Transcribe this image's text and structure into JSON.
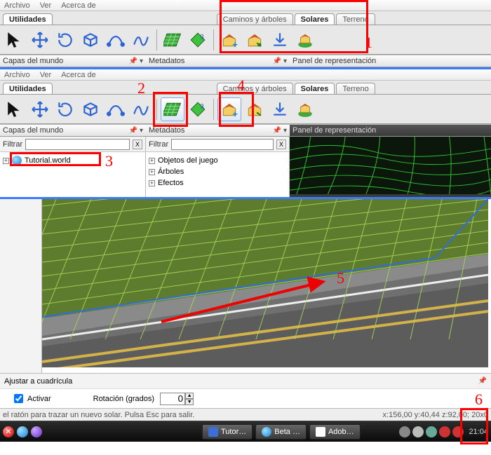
{
  "menu": {
    "archivo": "Archivo",
    "ver": "Ver",
    "acerca": "Acerca de"
  },
  "tabstrip1": {
    "utilidades": "Utilidades",
    "caminos": "Caminos y árboles",
    "solares": "Solares",
    "terreno": "Terreno"
  },
  "panels": {
    "capas": "Capas del mundo",
    "metadatos": "Metadatos",
    "render": "Panel de representación"
  },
  "filter": {
    "label": "Filtrar"
  },
  "tree": {
    "world": "Tutorial.world",
    "objetos": "Objetos del juego",
    "arboles": "Árboles",
    "efectos": "Efectos"
  },
  "markers": {
    "m1": "1",
    "m2": "2",
    "m3": "3",
    "m4": "4",
    "m5": "5",
    "m6": "6"
  },
  "ajustar": {
    "title": "Ajustar a cuadrícula",
    "activar": "Activar",
    "rotacion": "Rotación (grados)",
    "rot_val": "0"
  },
  "status": {
    "left": "el ratón para trazar un nuevo solar. Pulsa Esc para salir.",
    "right": "x:156,00 y:40,44 z:92,00; 20x0"
  },
  "taskbar": {
    "tutor": "Tutor…",
    "beta": "Beta …",
    "adob": "Adob…",
    "clock": "21:04"
  }
}
